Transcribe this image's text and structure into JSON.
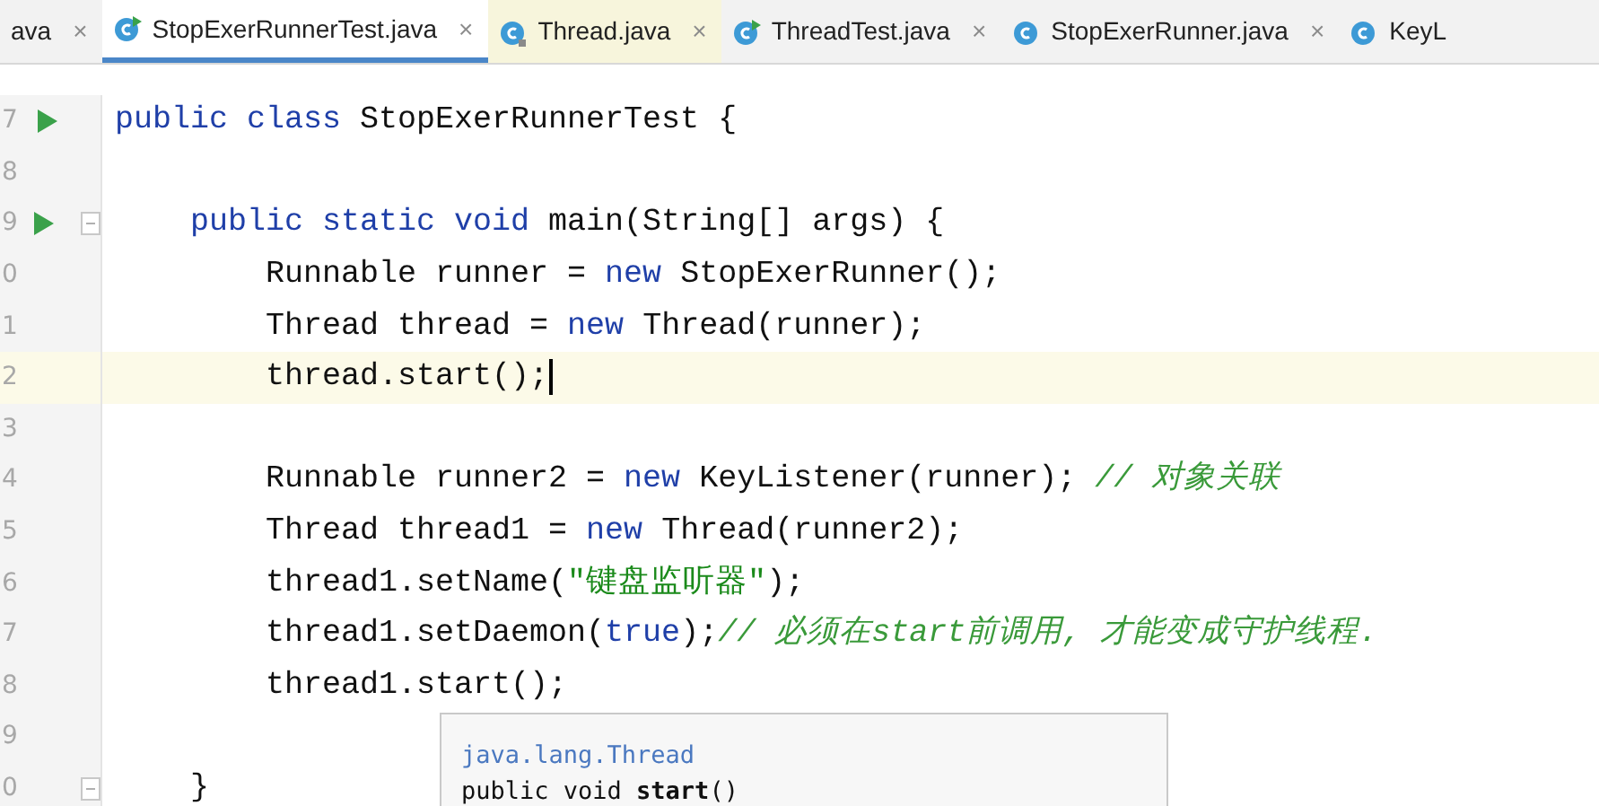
{
  "tabs": [
    {
      "label": "ava",
      "kind": "plain",
      "selected": false,
      "close": "×"
    },
    {
      "label": "StopExerRunnerTest.java",
      "kind": "runnable",
      "selected": true,
      "close": "×"
    },
    {
      "label": "Thread.java",
      "kind": "library",
      "selected": false,
      "close": "×"
    },
    {
      "label": "ThreadTest.java",
      "kind": "runnable",
      "selected": false,
      "close": "×"
    },
    {
      "label": "StopExerRunner.java",
      "kind": "class",
      "selected": false,
      "close": "×"
    },
    {
      "label": "KeyL",
      "kind": "class",
      "selected": false
    }
  ],
  "lines": [
    {
      "number": "7",
      "run": true,
      "fold": false,
      "current": false,
      "caret": false,
      "tokens": [
        {
          "kind": "keyword",
          "text": "public class "
        },
        {
          "kind": "plain",
          "text": "StopExerRunnerTest {"
        }
      ]
    },
    {
      "number": "8",
      "run": false,
      "fold": false,
      "current": false,
      "caret": false
    },
    {
      "number": "9",
      "run": true,
      "fold": true,
      "current": false,
      "caret": false,
      "tokens": [
        {
          "kind": "keyword",
          "text": "    public static void "
        },
        {
          "kind": "plain",
          "text": "main(String[] args) {"
        }
      ]
    },
    {
      "number": "0",
      "run": false,
      "fold": false,
      "current": false,
      "caret": false,
      "tokens": [
        {
          "kind": "plain",
          "text": "        Runnable runner = "
        },
        {
          "kind": "keyword",
          "text": "new "
        },
        {
          "kind": "plain",
          "text": "StopExerRunner();"
        }
      ]
    },
    {
      "number": "1",
      "run": false,
      "fold": false,
      "current": false,
      "caret": false,
      "tokens": [
        {
          "kind": "plain",
          "text": "        Thread thread = "
        },
        {
          "kind": "keyword",
          "text": "new "
        },
        {
          "kind": "plain",
          "text": "Thread(runner);"
        }
      ]
    },
    {
      "number": "2",
      "run": false,
      "fold": false,
      "current": true,
      "caret": true,
      "tokens": [
        {
          "kind": "plain",
          "text": "        thread.start();"
        }
      ]
    },
    {
      "number": "3",
      "run": false,
      "fold": false,
      "current": false,
      "caret": false
    },
    {
      "number": "4",
      "run": false,
      "fold": false,
      "current": false,
      "caret": false,
      "tokens": [
        {
          "kind": "plain",
          "text": "        Runnable runner2 = "
        },
        {
          "kind": "keyword",
          "text": "new "
        },
        {
          "kind": "plain",
          "text": "KeyListener(runner); "
        },
        {
          "kind": "comment",
          "text": "// 对象关联"
        }
      ]
    },
    {
      "number": "5",
      "run": false,
      "fold": false,
      "current": false,
      "caret": false,
      "tokens": [
        {
          "kind": "plain",
          "text": "        Thread thread1 = "
        },
        {
          "kind": "keyword",
          "text": "new "
        },
        {
          "kind": "plain",
          "text": "Thread(runner2);"
        }
      ]
    },
    {
      "number": "6",
      "run": false,
      "fold": false,
      "current": false,
      "caret": false,
      "tokens": [
        {
          "kind": "plain",
          "text": "        thread1.setName("
        },
        {
          "kind": "string",
          "text": "\"键盘监听器\""
        },
        {
          "kind": "plain",
          "text": ");"
        }
      ]
    },
    {
      "number": "7",
      "run": false,
      "fold": false,
      "current": false,
      "caret": false,
      "tokens": [
        {
          "kind": "plain",
          "text": "        thread1.setDaemon("
        },
        {
          "kind": "keyword",
          "text": "true"
        },
        {
          "kind": "plain",
          "text": ");"
        },
        {
          "kind": "comment",
          "text": "// 必须在start前调用, 才能变成守护线程."
        }
      ]
    },
    {
      "number": "8",
      "run": false,
      "fold": false,
      "current": false,
      "caret": false,
      "tokens": [
        {
          "kind": "plain",
          "text": "        thread1.start();"
        }
      ]
    },
    {
      "number": "9",
      "run": false,
      "fold": false,
      "current": false,
      "caret": false
    },
    {
      "number": "0",
      "run": false,
      "fold": true,
      "current": false,
      "caret": false,
      "tokens": [
        {
          "kind": "plain",
          "text": "    }"
        }
      ]
    }
  ],
  "tooltip": {
    "package": "java.lang.Thread",
    "signature": "public void **start**()"
  }
}
